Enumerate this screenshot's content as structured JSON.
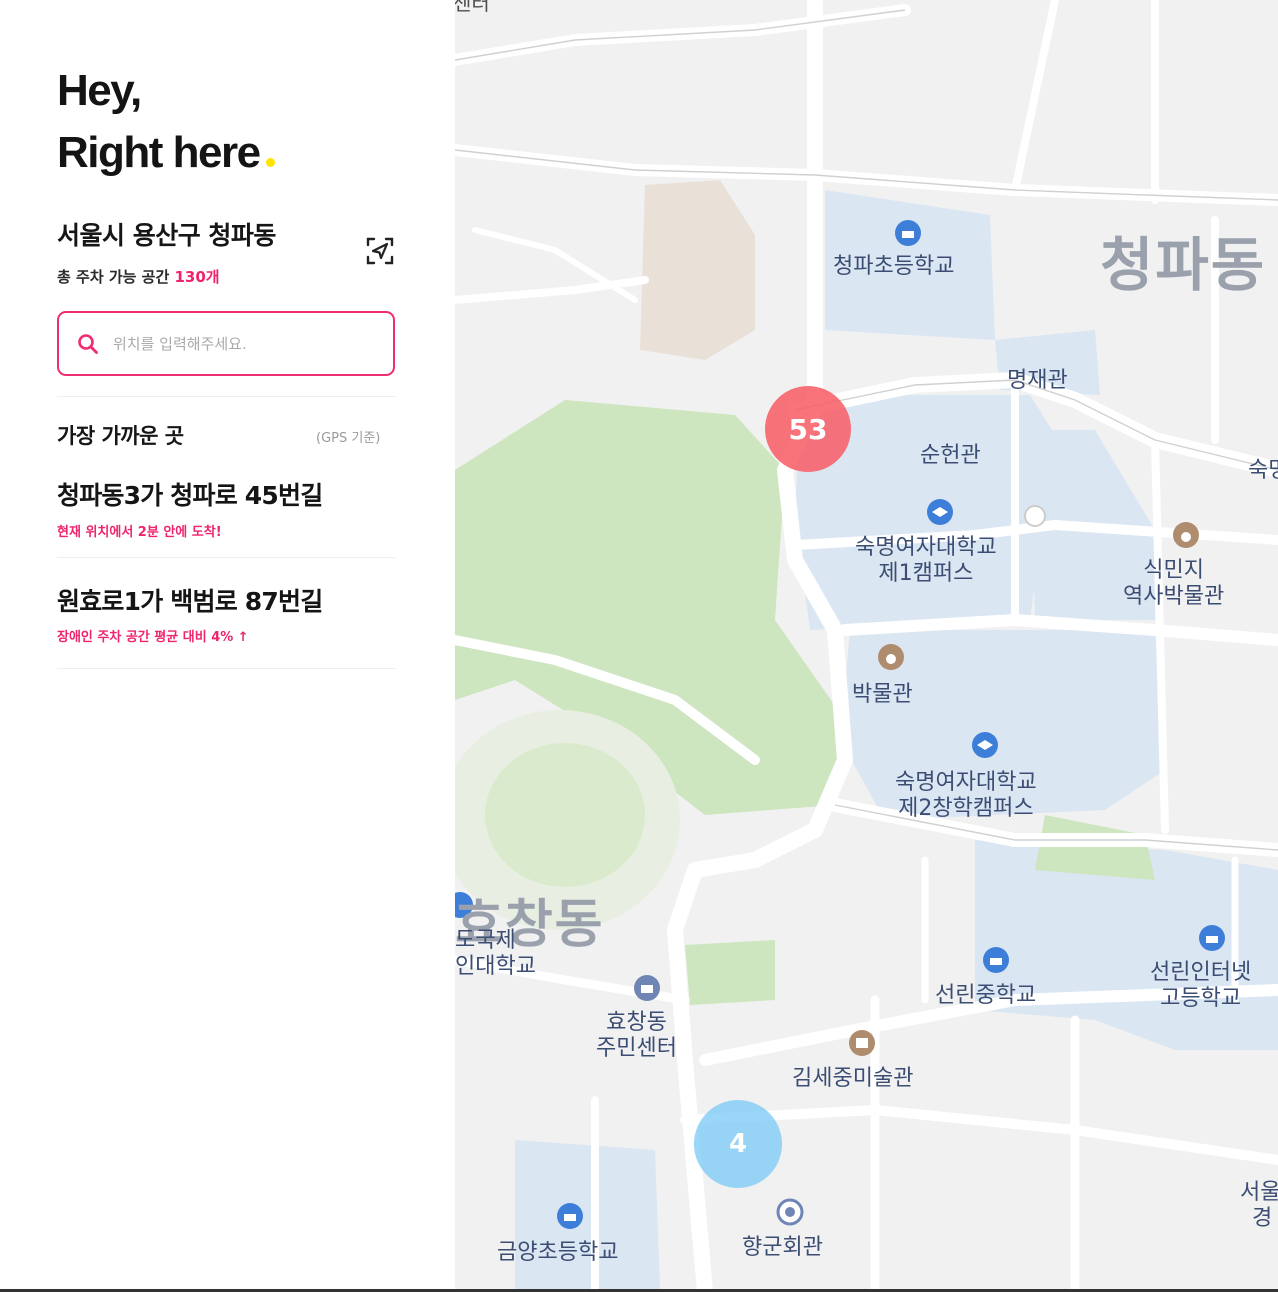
{
  "hero": {
    "line1": "Hey,",
    "line2": "Right here"
  },
  "location": {
    "title": "서울시 용산구 청파동",
    "total_prefix": "총 주차 가능 공간 ",
    "total_count": "130개",
    "locate_icon": "locate-arrow-icon"
  },
  "search": {
    "placeholder": "위치를 입력해주세요.",
    "icon": "search-icon"
  },
  "nearest": {
    "heading": "가장 가까운 곳",
    "note": "(GPS 기준)",
    "places": [
      {
        "title": "청파동3가 청파로 45번길",
        "sub": "현재 위치에서 2분 안에 도착!"
      },
      {
        "title": "원효로1가 백범로 87번길",
        "sub": "장애인 주차 공간 평균 대비 4% ↑"
      }
    ]
  },
  "map": {
    "districts": [
      "청파동",
      "효창동"
    ],
    "labels": {
      "top_edge": "센터",
      "cheongpa_school": "청파초등학교",
      "myeongjae": "명재관",
      "sunheon": "순헌관",
      "sookmyung_right": "숙명",
      "sookmyung1": [
        "숙명여자대학교",
        "제1캠퍼스"
      ],
      "sikminji": [
        "식민지",
        "역사박물관"
      ],
      "museum": "박물관",
      "sookmyung2": [
        "숙명여자대학교",
        "제2창학캠퍼스"
      ],
      "hanguk": [
        "도국제",
        "인대학교"
      ],
      "hyochang_center": [
        "효창동",
        "주민센터"
      ],
      "seonrin_middle": "선린중학교",
      "seonrin_high": [
        "선린인터넷",
        "고등학교"
      ],
      "kimsejung": "김세중미술관",
      "geumyang": "금양초등학교",
      "hyanggun": "향군회관",
      "seoul_edge": [
        "서울",
        "경"
      ]
    },
    "clusters": [
      {
        "count": "53",
        "color": "#f85a64"
      },
      {
        "count": "4",
        "color": "#78c8f5"
      }
    ],
    "colors": {
      "campus": "#dbe6f3",
      "park": "#cde6bf",
      "road": "#ffffff",
      "base": "#f1f1f1",
      "accent": "#ef2d72",
      "highlight": "#ffe400"
    }
  }
}
